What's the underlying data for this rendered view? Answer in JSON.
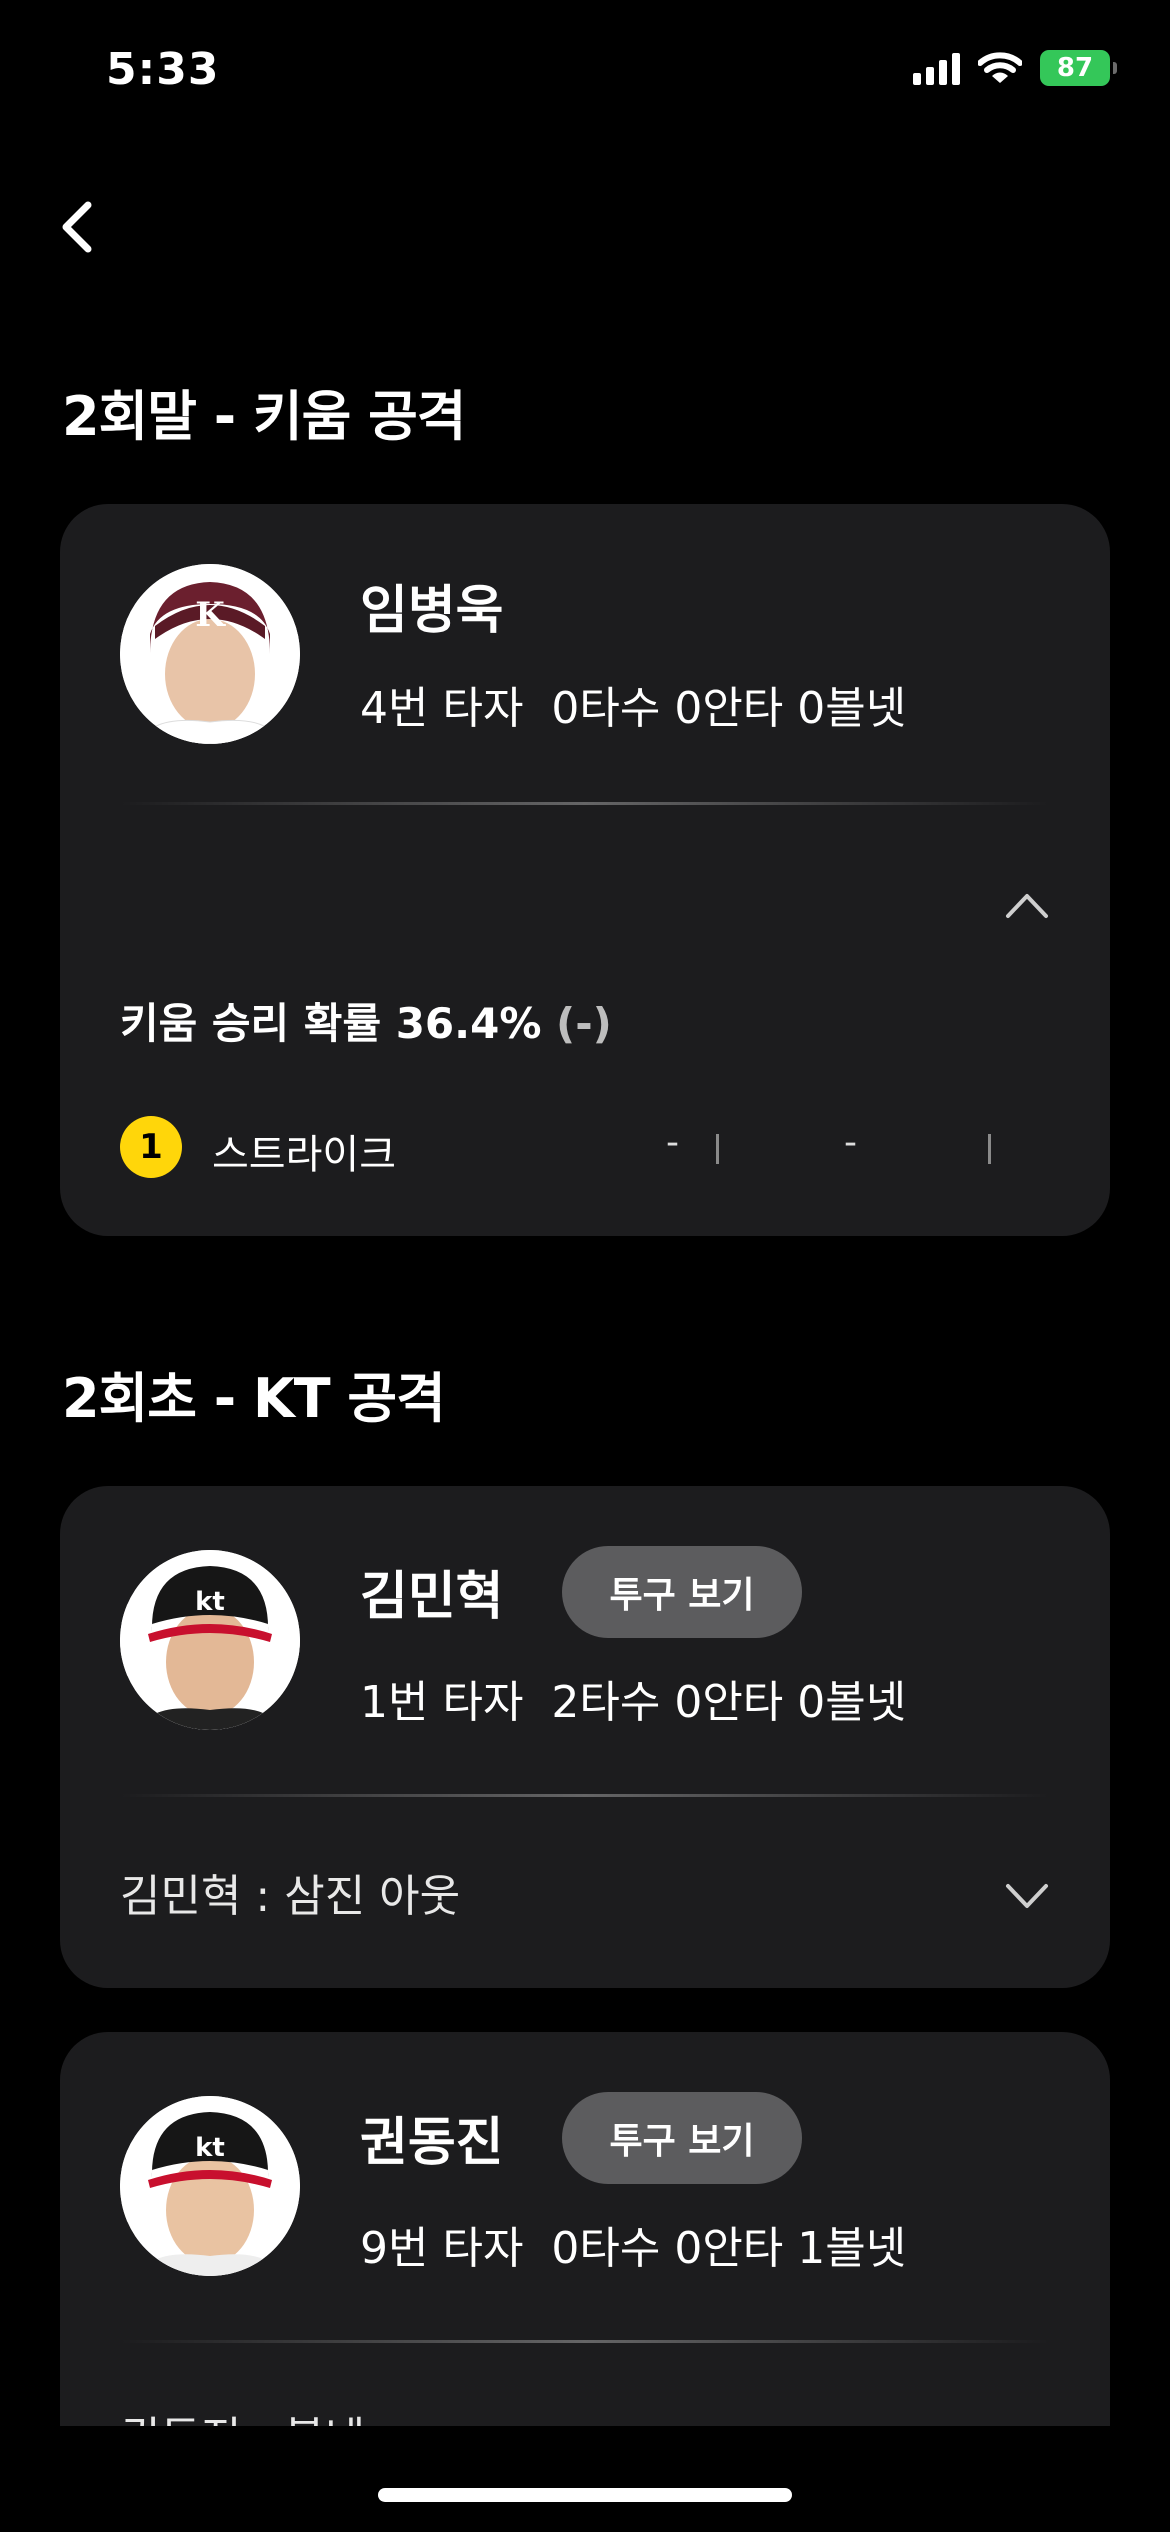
{
  "status_bar": {
    "time": "5:33",
    "battery": "87"
  },
  "sections": [
    {
      "title": "2회말 - 키움 공격",
      "batter": {
        "name": "임병욱",
        "stats": "4번 타자  0타수 0안타 0볼넷",
        "win_probability": "키움 승리 확률 36.4%",
        "win_probability_delta": "(-)",
        "pitches": [
          {
            "number": "1",
            "type": "스트라이크",
            "value1": "-",
            "value2": "-"
          }
        ]
      }
    },
    {
      "title": "2회초 - KT 공격",
      "batters": [
        {
          "name": "김민혁",
          "button": "투구 보기",
          "stats": "1번 타자  2타수 0안타 0볼넷",
          "result": "김민혁 : 삼진 아웃"
        },
        {
          "name": "권동진",
          "button": "투구 보기",
          "stats": "9번 타자  0타수 0안타 1볼넷",
          "result": "권동진 : 볼넷"
        }
      ]
    }
  ],
  "colors": {
    "background": "#000000",
    "card": "#1c1c1e",
    "accent_yellow": "#ffd60a",
    "battery_green": "#34c759"
  },
  "icons": [
    "back-chevron-icon",
    "chevron-up-icon",
    "chevron-down-icon",
    "signal-icon",
    "wifi-icon",
    "battery-icon"
  ]
}
